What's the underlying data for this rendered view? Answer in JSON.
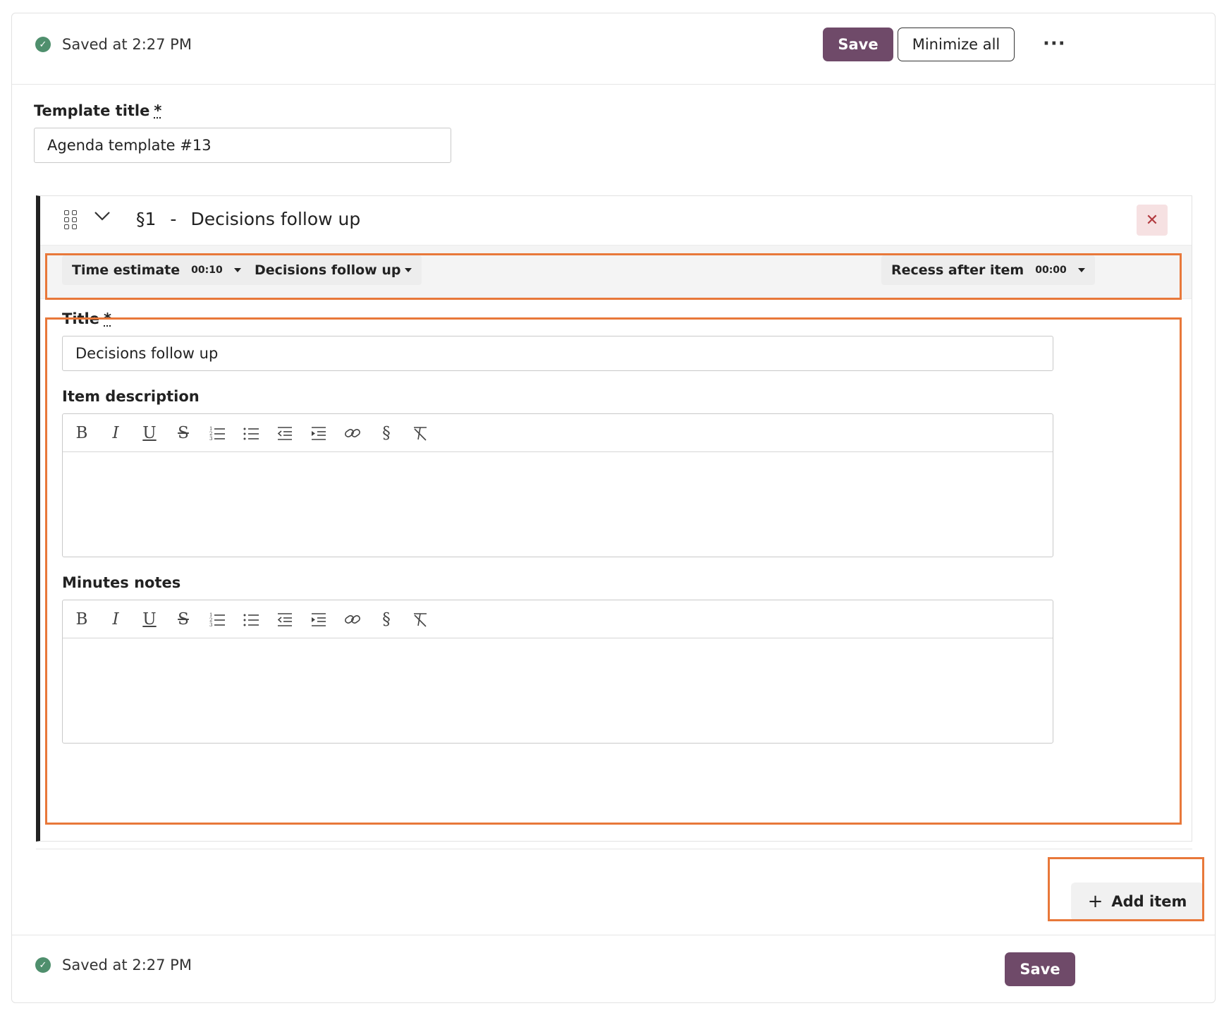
{
  "header": {
    "saved_status": "Saved at 2:27 PM",
    "save_label": "Save",
    "minimize_label": "Minimize all",
    "more_label": "···"
  },
  "template": {
    "title_label": "Template title",
    "required_mark": "*",
    "title_value": "Agenda template #13"
  },
  "agenda_item": {
    "number": "§1",
    "separator": "-",
    "heading": "Decisions follow up",
    "close_label": "✕",
    "time_estimate_label": "Time estimate",
    "time_estimate_value": "00:10",
    "category_label": "Decisions follow up",
    "recess_label": "Recess after item",
    "recess_value": "00:00",
    "title_label": "Title",
    "required_mark": "*",
    "title_value": "Decisions follow up",
    "description_label": "Item description",
    "minutes_label": "Minutes notes"
  },
  "toolbar_icons": [
    "bold-icon",
    "italic-icon",
    "underline-icon",
    "strikethrough-icon",
    "ordered-list-icon",
    "bullet-list-icon",
    "outdent-icon",
    "indent-icon",
    "link-icon",
    "section-icon",
    "clear-format-icon"
  ],
  "actions": {
    "add_item_label": "Add item"
  },
  "footer": {
    "saved_status": "Saved at 2:27 PM",
    "save_label": "Save"
  },
  "colors": {
    "primary": "#6f4a69",
    "success": "#4f8f6d",
    "highlight": "#e8783a",
    "danger_bg": "#f6e1e2"
  }
}
